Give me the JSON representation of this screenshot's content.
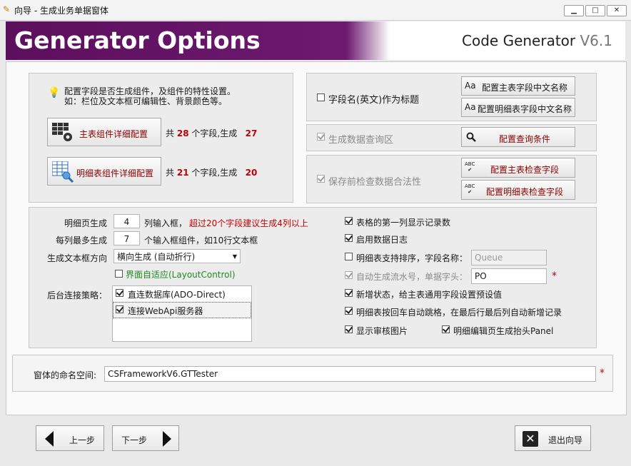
{
  "window": {
    "title": "向导 - 生成业务单据窗体"
  },
  "header": {
    "title": "Generator Options",
    "product": "Code Generator",
    "version": "V6.1"
  },
  "info": {
    "line1": "配置字段是否生成组件，及组件的特性设置。",
    "line2": "如：栏位及文本框可编辑性、背景颜色等。"
  },
  "main_detail": {
    "label": "主表组件详细配置",
    "prefix": "共",
    "count": "28",
    "mid": "个字段,生成",
    "gen": "27"
  },
  "sub_detail": {
    "label": "明细表组件详细配置",
    "prefix": "共",
    "count": "21",
    "mid": "个字段,生成",
    "gen": "20"
  },
  "title_option": {
    "label": "字段名(英文)作为标题",
    "checked": false
  },
  "btn_main_cn": "配置主表字段中文名称",
  "btn_sub_cn": "配置明细表字段中文名称",
  "query_option": {
    "label": "生成数据查询区",
    "checked": true,
    "disabled": true
  },
  "btn_query": "配置查询条件",
  "validate_option": {
    "label": "保存前检查数据合法性",
    "checked": true,
    "disabled": true
  },
  "btn_main_check": "配置主表检查字段",
  "btn_sub_check": "配置明细表检查字段",
  "detail_page": {
    "label": "明细页生成",
    "value": "4",
    "suffix": "列输入框，",
    "warning": "超过20个字段建议生成4列以上"
  },
  "per_col": {
    "label": "每列最多生成",
    "value": "7",
    "suffix": "个输入框组件，如10行文本框"
  },
  "direction": {
    "label": "生成文本框方向",
    "value": "横向生成 (自动折行)"
  },
  "adaptive": {
    "label": "界面自适应(LayoutControl)",
    "checked": false
  },
  "backend": {
    "label": "后台连接策略：",
    "items": [
      {
        "label": "直连数据库(ADO-Direct)",
        "checked": true
      },
      {
        "label": "连接WebApi服务器",
        "checked": true
      }
    ]
  },
  "right_opts": {
    "first_col": {
      "label": "表格的第一列显示记录数",
      "checked": true
    },
    "log": {
      "label": "启用数据日志",
      "checked": true
    },
    "sort": {
      "label": "明细表支持排序，字段名称：",
      "checked": false,
      "placeholder": "Queue"
    },
    "serial": {
      "label": "自动生成流水号，单据字头：",
      "checked": true,
      "disabled": true,
      "value": "PO",
      "required": "*"
    },
    "new_state": {
      "label": "新增状态，给主表通用字段设置预设值",
      "checked": true
    },
    "enter_jump": {
      "label": "明细表按回车自动跳格，在最后行最后列自动新增记录",
      "checked": true
    },
    "audit_img": {
      "label": "显示审核图片",
      "checked": true
    },
    "header_panel": {
      "label": "明细编辑页生成抬头Panel",
      "checked": true
    }
  },
  "namespace": {
    "label": "窗体的命名空间:",
    "value": "CSFrameworkV6.GTTester",
    "required": "*"
  },
  "nav": {
    "prev": "上一步",
    "next": "下一步",
    "exit": "退出向导"
  }
}
